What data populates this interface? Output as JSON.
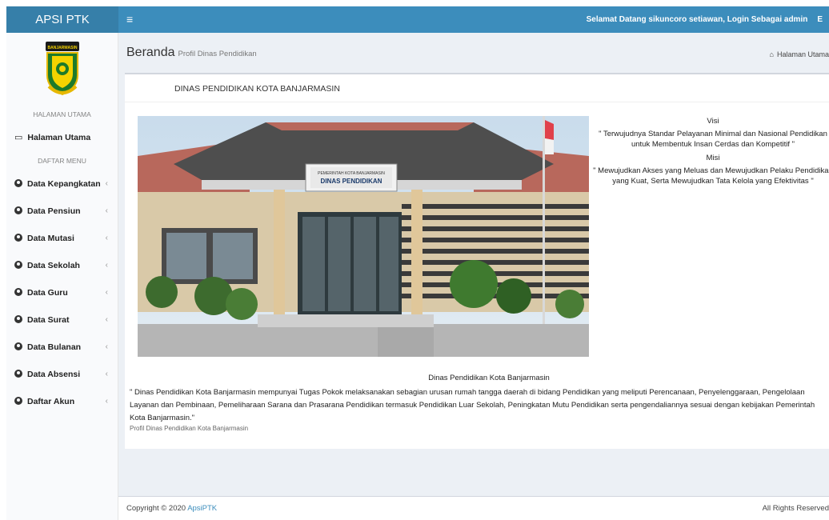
{
  "header": {
    "brand": "APSI PTK",
    "toggle_icon": "≡",
    "welcome": "Selamat Datang sikuncoro setiawan, Login Sebagai admin",
    "extra": "E"
  },
  "sidebar": {
    "logo_text": "BANJARMASIN",
    "section_main": "HALAMAN UTAMA",
    "home_item": "Halaman Utama",
    "section_menu": "DAFTAR MENU",
    "items": [
      {
        "label": "Data Kepangkatan"
      },
      {
        "label": "Data Pensiun"
      },
      {
        "label": "Data Mutasi"
      },
      {
        "label": "Data Sekolah"
      },
      {
        "label": "Data Guru"
      },
      {
        "label": "Data Surat"
      },
      {
        "label": "Data Bulanan"
      },
      {
        "label": "Data Absensi"
      },
      {
        "label": "Daftar Akun"
      }
    ]
  },
  "page": {
    "title": "Beranda",
    "subtitle": "Profil Dinas Pendidikan",
    "breadcrumb": "Halaman Utama"
  },
  "box": {
    "title": "DINAS PENDIDIKAN KOTA BANJARMASIN",
    "sign_line1": "PEMERINTAH KOTA BANJARMASIN",
    "sign_line2": "DINAS PENDIDIKAN",
    "visi_heading": "Visi",
    "visi_text": "\" Terwujudnya Standar Pelayanan Minimal dan Nasional Pendidikan untuk Membentuk Insan Cerdas dan Kompetitif \"",
    "misi_heading": "Misi",
    "misi_text": "\" Mewujudkan Akses yang Meluas dan Mewujudkan Pelaku Pendidikan yang Kuat, Serta Mewujudkan Tata Kelola yang Efektivitas \"",
    "desc_title": "Dinas Pendidikan Kota Banjarmasin",
    "desc_text": "\" Dinas Pendidikan Kota Banjarmasin mempunyai Tugas Pokok melaksanakan sebagian urusan rumah tangga daerah di bidang Pendidikan yang meliputi Perencanaan, Penyelenggaraan, Pengelolaan Layanan dan Pembinaan, Pemeliharaan Sarana dan Prasarana Pendidikan termasuk Pendidikan Luar Sekolah, Peningkatan Mutu Pendidikan serta pengendaliannya sesuai dengan kebijakan Pemerintah Kota Banjarmasin.\"",
    "desc_foot": "Profil Dinas Pendidikan Kota Banjarmasin"
  },
  "footer": {
    "copyright": "Copyright © 2020 ",
    "brand_link": "ApsiPTK",
    "rights": "All Rights Reserved"
  },
  "colors": {
    "header": "#3c8dbc",
    "brand_bg": "#367fa9",
    "content_bg": "#ecf0f5",
    "link": "#3c8dbc"
  },
  "icons": {
    "toggle": "hamburger-icon",
    "home_item": "monitor-icon",
    "menu_items": "circle-icon",
    "chevron": "chevron-left-icon",
    "breadcrumb": "home-icon"
  }
}
